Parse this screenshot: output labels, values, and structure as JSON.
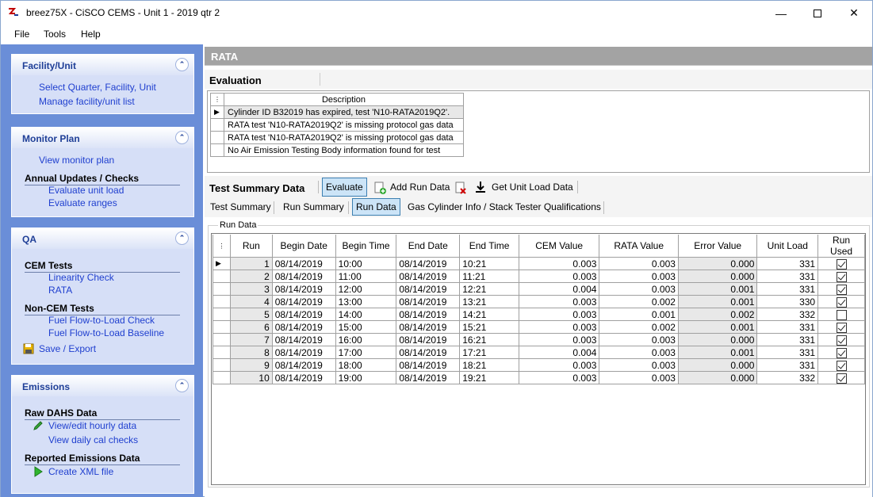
{
  "window": {
    "title": "breez75X - CiSCO CEMS - Unit 1 - 2019 qtr 2"
  },
  "menu": [
    "File",
    "Tools",
    "Help"
  ],
  "sidebar": {
    "facility": {
      "title": "Facility/Unit",
      "links": [
        "Select Quarter, Facility, Unit",
        "Manage facility/unit list"
      ]
    },
    "monitor": {
      "title": "Monitor Plan",
      "link": "View monitor plan",
      "section": "Annual Updates / Checks",
      "sublinks": [
        "Evaluate unit load",
        "Evaluate ranges"
      ]
    },
    "qa": {
      "title": "QA",
      "cem_section": "CEM Tests",
      "cem_links": [
        "Linearity Check",
        "RATA"
      ],
      "noncem_section": "Non-CEM Tests",
      "noncem_links": [
        "Fuel Flow-to-Load Check",
        "Fuel Flow-to-Load Baseline"
      ],
      "save": "Save / Export"
    },
    "emissions": {
      "title": "Emissions",
      "raw_section": "Raw DAHS Data",
      "raw_links": [
        "View/edit hourly data",
        "View daily cal checks"
      ],
      "reported_section": "Reported Emissions Data",
      "create": "Create XML file"
    }
  },
  "main": {
    "header": "RATA",
    "evaluation": {
      "title": "Evaluation",
      "column": "Description",
      "rows": [
        "Cylinder ID B32019 has expired, test 'N10-RATA2019Q2'.",
        "RATA test 'N10-RATA2019Q2' is missing protocol gas data",
        "RATA test 'N10-RATA2019Q2' is missing protocol gas data",
        "No Air Emission Testing Body information found for test"
      ]
    },
    "summary": {
      "title": "Test Summary Data",
      "evaluate": "Evaluate",
      "add_run": "Add Run Data",
      "get_load": "Get Unit Load Data"
    },
    "tabs": [
      "Test Summary",
      "Run Summary",
      "Run Data",
      "Gas Cylinder Info / Stack Tester Qualifications"
    ],
    "run_data": {
      "group_label": "Run Data",
      "columns": [
        "Run",
        "Begin Date",
        "Begin Time",
        "End Date",
        "End Time",
        "CEM Value",
        "RATA Value",
        "Error Value",
        "Unit Load",
        "Run Used"
      ],
      "rows": [
        {
          "run": "1",
          "begin_date": "08/14/2019",
          "begin_time": "10:00",
          "end_date": "08/14/2019",
          "end_time": "10:21",
          "cem": "0.003",
          "rata": "0.003",
          "error": "0.000",
          "load": "331",
          "used": true
        },
        {
          "run": "2",
          "begin_date": "08/14/2019",
          "begin_time": "11:00",
          "end_date": "08/14/2019",
          "end_time": "11:21",
          "cem": "0.003",
          "rata": "0.003",
          "error": "0.000",
          "load": "331",
          "used": true
        },
        {
          "run": "3",
          "begin_date": "08/14/2019",
          "begin_time": "12:00",
          "end_date": "08/14/2019",
          "end_time": "12:21",
          "cem": "0.004",
          "rata": "0.003",
          "error": "0.001",
          "load": "331",
          "used": true
        },
        {
          "run": "4",
          "begin_date": "08/14/2019",
          "begin_time": "13:00",
          "end_date": "08/14/2019",
          "end_time": "13:21",
          "cem": "0.003",
          "rata": "0.002",
          "error": "0.001",
          "load": "330",
          "used": true
        },
        {
          "run": "5",
          "begin_date": "08/14/2019",
          "begin_time": "14:00",
          "end_date": "08/14/2019",
          "end_time": "14:21",
          "cem": "0.003",
          "rata": "0.001",
          "error": "0.002",
          "load": "332",
          "used": false
        },
        {
          "run": "6",
          "begin_date": "08/14/2019",
          "begin_time": "15:00",
          "end_date": "08/14/2019",
          "end_time": "15:21",
          "cem": "0.003",
          "rata": "0.002",
          "error": "0.001",
          "load": "331",
          "used": true
        },
        {
          "run": "7",
          "begin_date": "08/14/2019",
          "begin_time": "16:00",
          "end_date": "08/14/2019",
          "end_time": "16:21",
          "cem": "0.003",
          "rata": "0.003",
          "error": "0.000",
          "load": "331",
          "used": true
        },
        {
          "run": "8",
          "begin_date": "08/14/2019",
          "begin_time": "17:00",
          "end_date": "08/14/2019",
          "end_time": "17:21",
          "cem": "0.004",
          "rata": "0.003",
          "error": "0.001",
          "load": "331",
          "used": true
        },
        {
          "run": "9",
          "begin_date": "08/14/2019",
          "begin_time": "18:00",
          "end_date": "08/14/2019",
          "end_time": "18:21",
          "cem": "0.003",
          "rata": "0.003",
          "error": "0.000",
          "load": "331",
          "used": true
        },
        {
          "run": "10",
          "begin_date": "08/14/2019",
          "begin_time": "19:00",
          "end_date": "08/14/2019",
          "end_time": "19:21",
          "cem": "0.003",
          "rata": "0.003",
          "error": "0.000",
          "load": "332",
          "used": true
        }
      ]
    }
  }
}
